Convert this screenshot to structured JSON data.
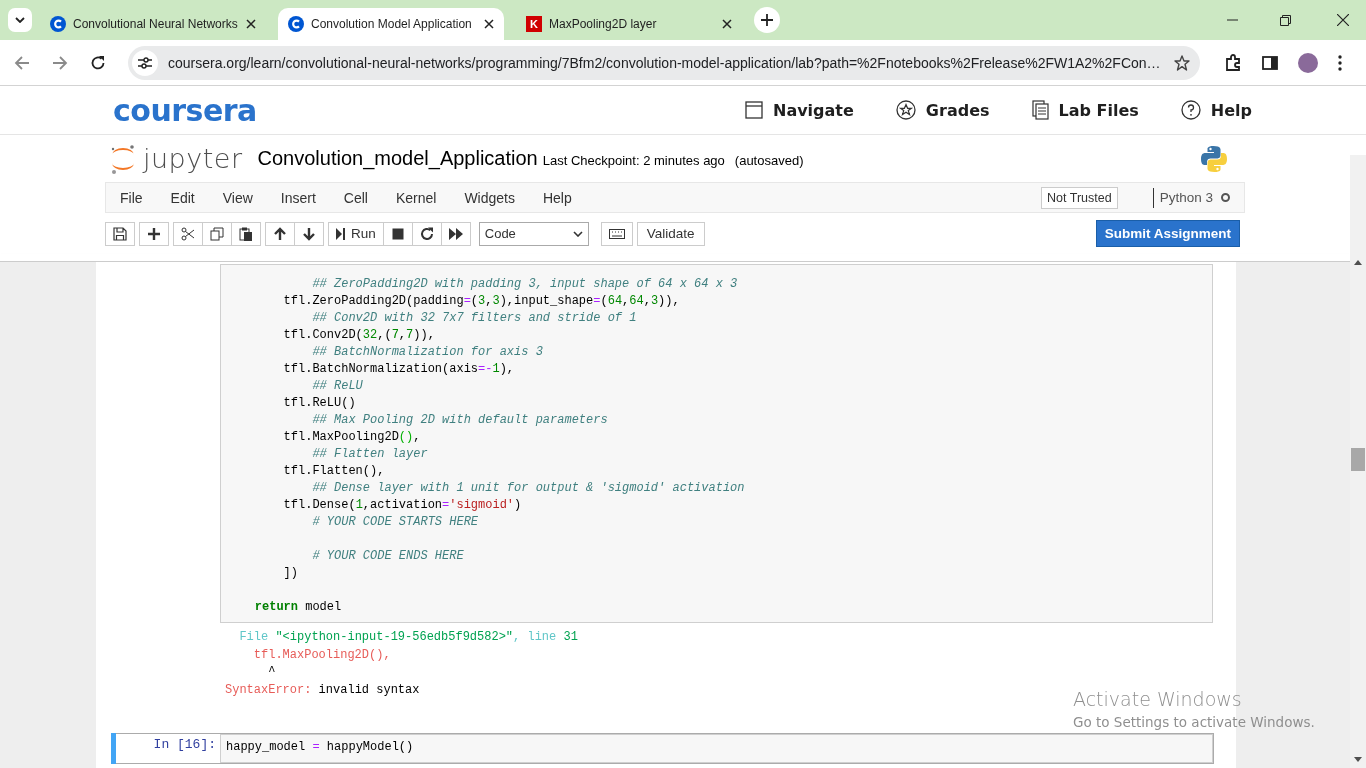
{
  "browser": {
    "tabs": [
      {
        "title": "Convolutional Neural Networks",
        "kind": "coursera",
        "selected": false
      },
      {
        "title": "Convolution Model Application",
        "kind": "coursera",
        "selected": true
      },
      {
        "title": "MaxPooling2D layer",
        "kind": "letter",
        "icon_text": "K",
        "selected": false
      }
    ],
    "url": "coursera.org/learn/convolutional-neural-networks/programming/7Bfm2/convolution-model-application/lab?path=%2Fnotebooks%2Frelease%2FW1A2%2FCon…"
  },
  "site_header": {
    "logo": "coursera",
    "nav": [
      {
        "label": "Navigate",
        "kind": "window"
      },
      {
        "label": "Grades",
        "kind": "star"
      },
      {
        "label": "Lab Files",
        "kind": "files"
      },
      {
        "label": "Help",
        "kind": "help"
      }
    ]
  },
  "notebook": {
    "logo_text": "jupyter",
    "title": "Convolution_model_Application",
    "checkpoint": "Last Checkpoint: 2 minutes ago",
    "autosave": "(autosaved)",
    "menu": [
      "File",
      "Edit",
      "View",
      "Insert",
      "Cell",
      "Kernel",
      "Widgets",
      "Help"
    ],
    "trust": "Not Trusted",
    "kernel": "Python 3",
    "kernel_busy": false,
    "run_label": "Run",
    "cell_type": "Code",
    "validate": "Validate",
    "submit": "Submit Assignment"
  },
  "cells": [
    {
      "selected": false,
      "lines": [
        {
          "blank_before": false,
          "tokens": [
            {
              "kind": "comment",
              "text": "            ## ZeroPadding2D with padding 3, input shape of 64 x 64 x 3"
            }
          ]
        },
        {
          "blank_before": false,
          "tokens": [
            {
              "kind": "plain",
              "text": "        tfl.ZeroPadding2D(padding"
            },
            {
              "kind": "op",
              "text": "="
            },
            {
              "kind": "plain",
              "text": "("
            },
            {
              "kind": "num",
              "text": "3"
            },
            {
              "kind": "plain",
              "text": ","
            },
            {
              "kind": "num",
              "text": "3"
            },
            {
              "kind": "plain",
              "text": "),input_shape"
            },
            {
              "kind": "op",
              "text": "="
            },
            {
              "kind": "plain",
              "text": "("
            },
            {
              "kind": "num",
              "text": "64"
            },
            {
              "kind": "plain",
              "text": ","
            },
            {
              "kind": "num",
              "text": "64"
            },
            {
              "kind": "plain",
              "text": ","
            },
            {
              "kind": "num",
              "text": "3"
            },
            {
              "kind": "plain",
              "text": ")),"
            }
          ]
        },
        {
          "blank_before": false,
          "tokens": [
            {
              "kind": "comment",
              "text": "            ## Conv2D with 32 7x7 filters and stride of 1"
            }
          ]
        },
        {
          "blank_before": false,
          "tokens": [
            {
              "kind": "plain",
              "text": "        tfl.Conv2D("
            },
            {
              "kind": "num",
              "text": "32"
            },
            {
              "kind": "plain",
              "text": ",("
            },
            {
              "kind": "num",
              "text": "7"
            },
            {
              "kind": "plain",
              "text": ","
            },
            {
              "kind": "num",
              "text": "7"
            },
            {
              "kind": "plain",
              "text": ")),"
            }
          ]
        },
        {
          "blank_before": false,
          "tokens": [
            {
              "kind": "comment",
              "text": "            ## BatchNormalization for axis 3"
            }
          ]
        },
        {
          "blank_before": false,
          "tokens": [
            {
              "kind": "plain",
              "text": "        tfl.BatchNormalization(axis"
            },
            {
              "kind": "op",
              "text": "=-"
            },
            {
              "kind": "num",
              "text": "1"
            },
            {
              "kind": "plain",
              "text": "),"
            }
          ]
        },
        {
          "blank_before": false,
          "tokens": [
            {
              "kind": "comment",
              "text": "            ## ReLU"
            }
          ]
        },
        {
          "blank_before": false,
          "tokens": [
            {
              "kind": "plain",
              "text": "        tfl.ReLU()"
            }
          ]
        },
        {
          "blank_before": false,
          "tokens": [
            {
              "kind": "comment",
              "text": "            ## Max Pooling 2D with default parameters"
            }
          ]
        },
        {
          "blank_before": false,
          "tokens": [
            {
              "kind": "plain",
              "text": "        tfl.MaxPooling2D"
            },
            {
              "kind": "match",
              "text": "()"
            },
            {
              "kind": "plain",
              "text": ","
            }
          ]
        },
        {
          "blank_before": false,
          "tokens": [
            {
              "kind": "comment",
              "text": "            ## Flatten layer"
            }
          ]
        },
        {
          "blank_before": false,
          "tokens": [
            {
              "kind": "plain",
              "text": "        tfl.Flatten(),"
            }
          ]
        },
        {
          "blank_before": false,
          "tokens": [
            {
              "kind": "comment",
              "text": "            ## Dense layer with 1 unit for output & 'sigmoid' activation"
            }
          ]
        },
        {
          "blank_before": false,
          "tokens": [
            {
              "kind": "plain",
              "text": "        tfl.Dense("
            },
            {
              "kind": "num",
              "text": "1"
            },
            {
              "kind": "plain",
              "text": ",activation"
            },
            {
              "kind": "op",
              "text": "="
            },
            {
              "kind": "string",
              "text": "'sigmoid'"
            },
            {
              "kind": "plain",
              "text": ")"
            }
          ]
        },
        {
          "blank_before": false,
          "tokens": [
            {
              "kind": "comment",
              "text": "            # YOUR CODE STARTS HERE"
            }
          ]
        },
        {
          "blank_before": true,
          "tokens": [
            {
              "kind": "comment",
              "text": "            # YOUR CODE ENDS HERE"
            }
          ]
        },
        {
          "blank_before": false,
          "tokens": [
            {
              "kind": "plain",
              "text": "        ])"
            }
          ]
        },
        {
          "blank_before": true,
          "tokens": [
            {
              "kind": "keyword",
              "text": "    return"
            },
            {
              "kind": "plain",
              "text": " model"
            }
          ]
        }
      ],
      "output": [
        [
          {
            "kind": "ecyan",
            "text": "  File "
          },
          {
            "kind": "egreen",
            "text": "\"<ipython-input-19-56edb5f9d582>\""
          },
          {
            "kind": "ecyan",
            "text": ", line "
          },
          {
            "kind": "egreen",
            "text": "31"
          }
        ],
        [
          {
            "kind": "ered",
            "text": "    tfl.MaxPooling2D(),"
          }
        ],
        [
          {
            "kind": "plain",
            "text": "      ^"
          }
        ],
        [
          {
            "kind": "ered",
            "text": "SyntaxError:"
          },
          {
            "kind": "plain",
            "text": " invalid syntax"
          }
        ]
      ]
    },
    {
      "selected": true,
      "prompt": "In [16]:",
      "lines": [
        {
          "blank_before": false,
          "tokens": [
            {
              "kind": "plain",
              "text": "happy_model "
            },
            {
              "kind": "op",
              "text": "="
            },
            {
              "kind": "plain",
              "text": " happyModel()"
            }
          ]
        }
      ]
    }
  ],
  "overlay": {
    "title": "Activate Windows",
    "subtitle": "Go to Settings to activate Windows."
  }
}
